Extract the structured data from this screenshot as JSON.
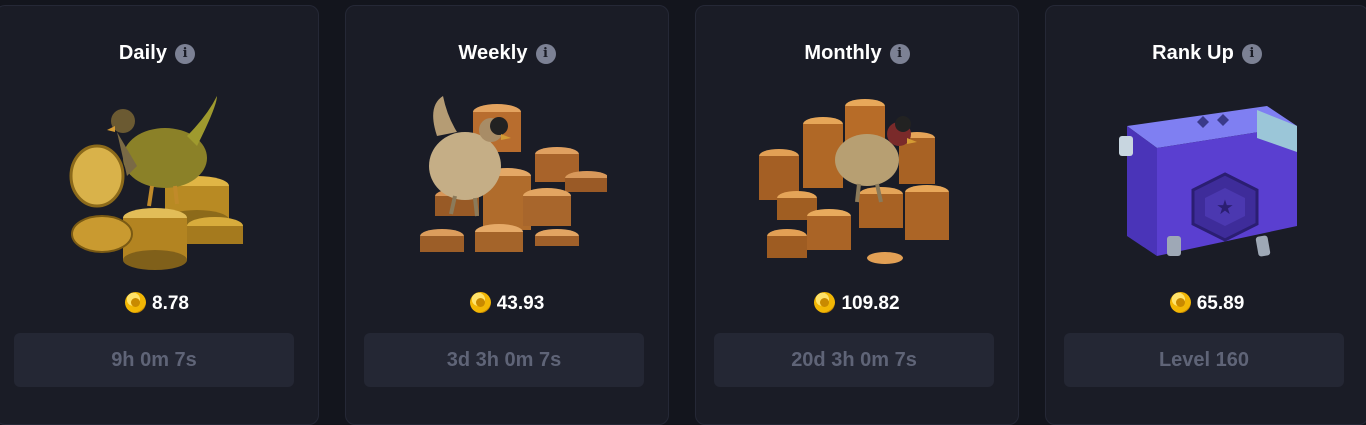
{
  "cards": [
    {
      "title": "Daily",
      "price": "8.78",
      "status": "9h 0m 7s",
      "art": "chicken-with-gold-coins"
    },
    {
      "title": "Weekly",
      "price": "43.93",
      "status": "3d 3h 0m 7s",
      "art": "chicken-with-bronze-coins"
    },
    {
      "title": "Monthly",
      "price": "109.82",
      "status": "20d 3h 0m 7s",
      "art": "chicken-with-copper-coin-stacks"
    },
    {
      "title": "Rank Up",
      "price": "65.89",
      "status": "Level 160",
      "art": "purple-loot-case"
    }
  ],
  "colors": {
    "background": "#13151d",
    "card": "#1a1c26",
    "button": "#242734",
    "muted_text": "#5f6477",
    "coin": "#f2b705",
    "case": "#5a3fd0"
  }
}
